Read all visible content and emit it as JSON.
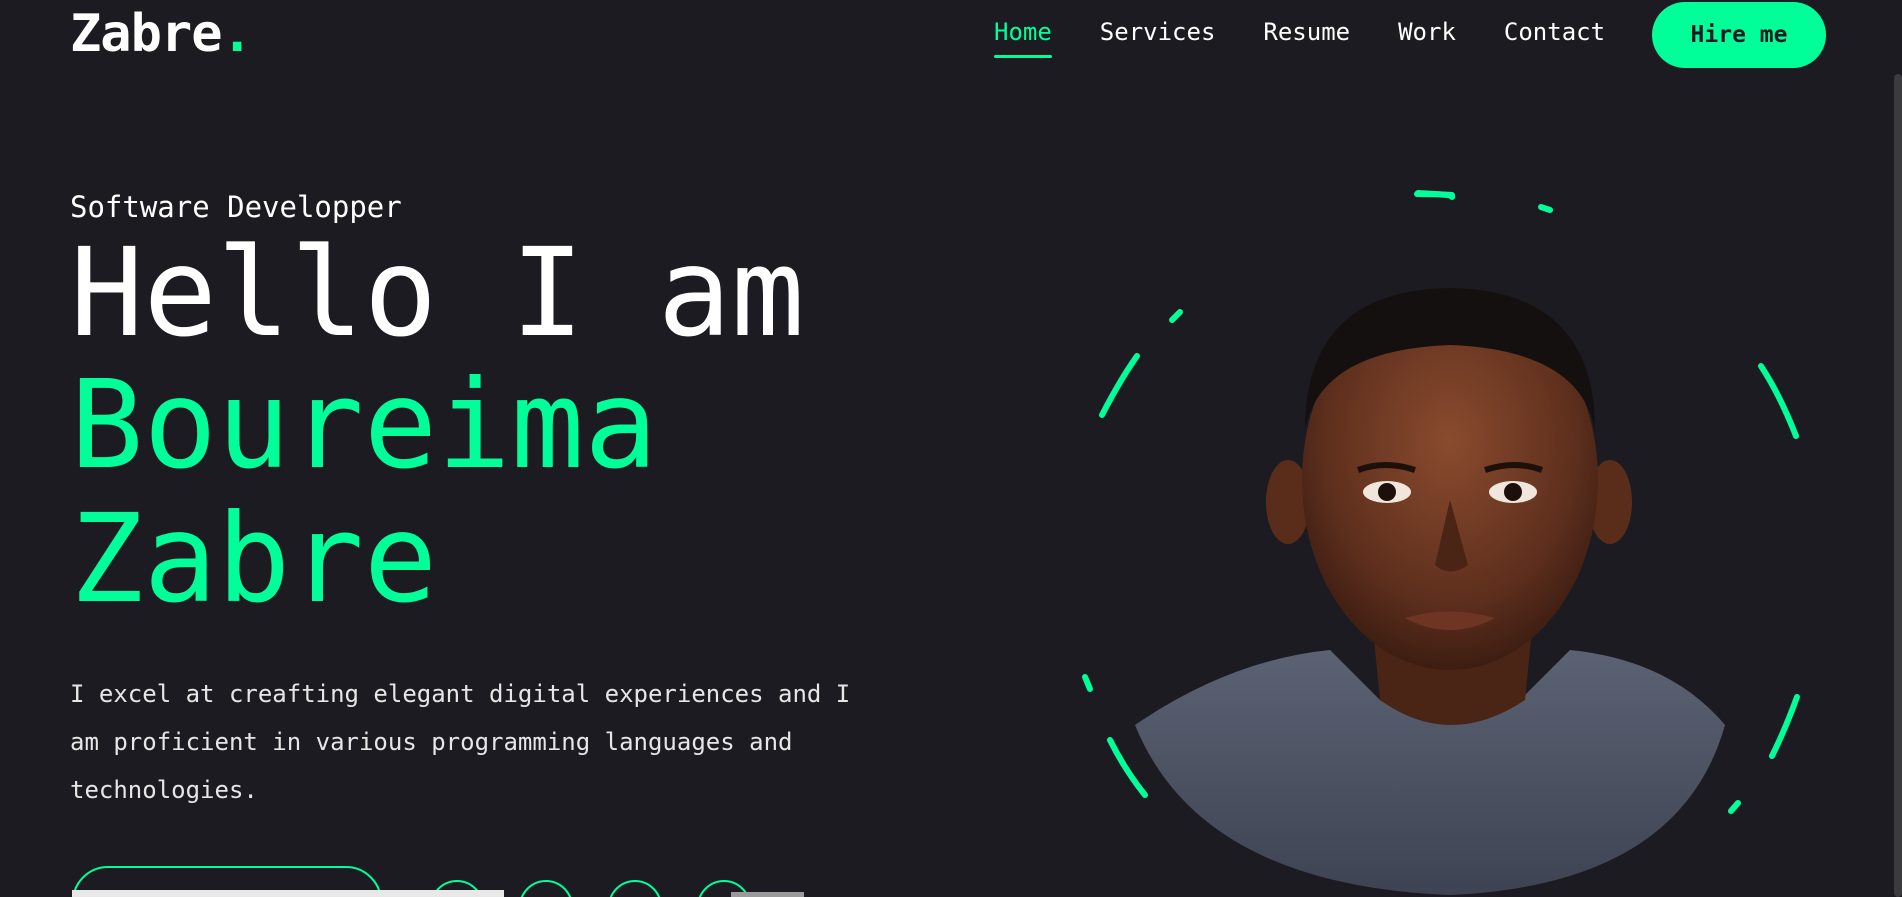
{
  "header": {
    "logo_text": "Zabre",
    "logo_dot": ".",
    "nav": [
      {
        "label": "Home",
        "active": true
      },
      {
        "label": "Services",
        "active": false
      },
      {
        "label": "Resume",
        "active": false
      },
      {
        "label": "Work",
        "active": false
      },
      {
        "label": "Contact",
        "active": false
      }
    ],
    "hire_label": "Hire me"
  },
  "hero": {
    "role": "Software Developper",
    "greeting": "Hello I am",
    "first_name": "Boureima",
    "last_name": "Zabre",
    "description": "I excel at creafting elegant digital experiences and I am proficient in various programming languages and technologies."
  },
  "colors": {
    "background": "#1c1b22",
    "accent": "#00ff99",
    "text": "#ffffff"
  }
}
